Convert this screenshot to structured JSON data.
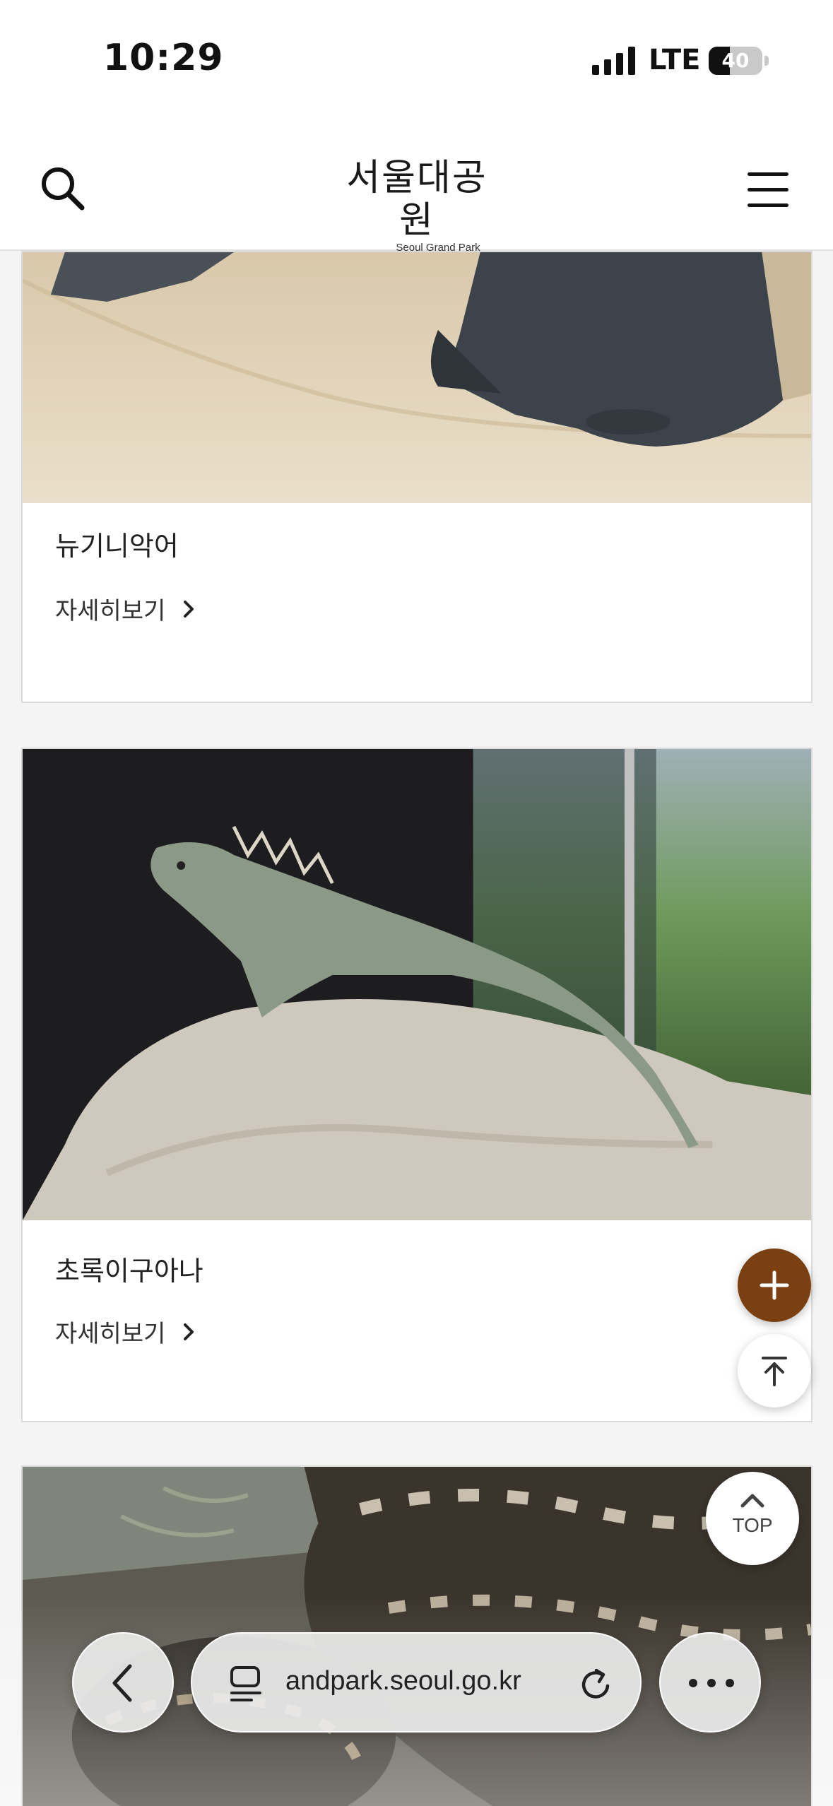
{
  "status_bar": {
    "time": "10:29",
    "network": "LTE",
    "battery": "40",
    "battery_level": 0.4
  },
  "header": {
    "logo_ko": "서울대공원",
    "logo_en": "Seoul Grand Park",
    "search_icon": "search-icon",
    "menu_icon": "hamburger-menu-icon"
  },
  "cards": [
    {
      "title": "뉴기니악어",
      "link": "자세히보기"
    },
    {
      "title": "초록이구아나",
      "link": "자세히보기"
    }
  ],
  "floating": {
    "plus_icon": "plus-icon",
    "scroll_top_icon": "arrow-to-top-icon",
    "top_label": "TOP",
    "plus_color": "#7a4012"
  },
  "browser": {
    "url": "andpark.seoul.go.kr",
    "back_icon": "chevron-left-icon",
    "tabs_icon": "page-format-icon",
    "reload_icon": "reload-icon",
    "more_icon": "ellipsis-icon"
  }
}
